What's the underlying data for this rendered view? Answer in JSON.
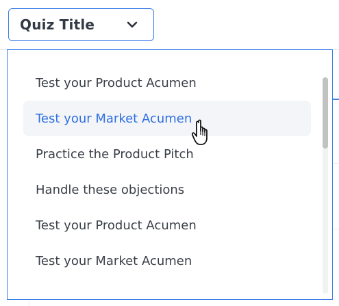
{
  "quiz_select": {
    "label": "Quiz Title",
    "icon": "chevron-down-icon"
  },
  "menu": {
    "items": [
      {
        "label": "Test your Product Acumen",
        "active": false
      },
      {
        "label": "Test your Market Acumen",
        "active": true
      },
      {
        "label": "Practice the Product Pitch",
        "active": false
      },
      {
        "label": "Handle these objections",
        "active": false
      },
      {
        "label": "Test your Product Acumen",
        "active": false
      },
      {
        "label": "Test your Market Acumen",
        "active": false
      }
    ]
  },
  "colors": {
    "accent": "#3d7eea",
    "active_text": "#2f6fe0",
    "hover_bg": "#f3f5f9",
    "text": "#3a3f47"
  },
  "cursor": "hand-pointer-icon"
}
